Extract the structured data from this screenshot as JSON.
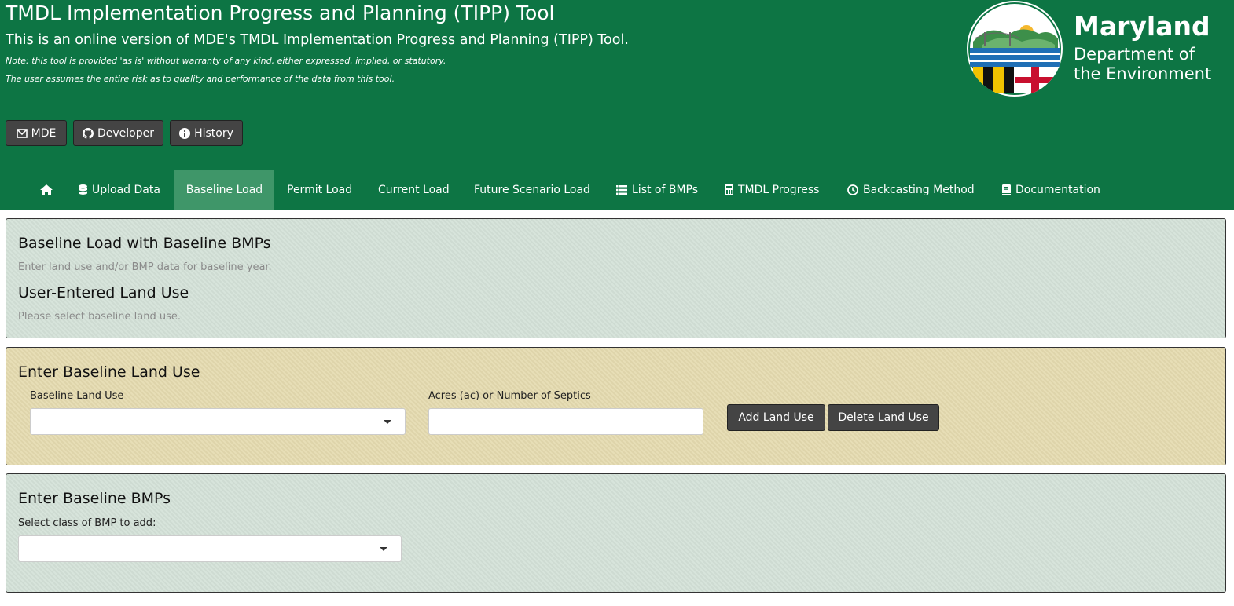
{
  "header": {
    "title": "TMDL Implementation Progress and Planning (TIPP) Tool",
    "subtitle": "This is an online version of MDE's TMDL Implementation Progress and Planning (TIPP) Tool.",
    "note1": "Note: this tool is provided 'as is' without warranty of any kind, either expressed, implied, or statutory.",
    "note2": "The user assumes the entire risk as to quality and performance of the data from this tool.",
    "buttons": [
      {
        "label": "MDE",
        "icon": "envelope-icon"
      },
      {
        "label": "Developer",
        "icon": "github-icon"
      },
      {
        "label": "History",
        "icon": "info-circle-icon"
      }
    ],
    "logo": {
      "line1": "Maryland",
      "line2": "Department of",
      "line3": "the Environment"
    },
    "bg_color": "#0d7544"
  },
  "nav": {
    "active": "Baseline Load",
    "items": [
      {
        "label": "",
        "icon": "home-icon"
      },
      {
        "label": "Upload Data",
        "icon": "database-icon"
      },
      {
        "label": "Baseline Load",
        "icon": ""
      },
      {
        "label": "Permit Load",
        "icon": ""
      },
      {
        "label": "Current Load",
        "icon": ""
      },
      {
        "label": "Future Scenario Load",
        "icon": ""
      },
      {
        "label": "List of BMPs",
        "icon": "list-icon"
      },
      {
        "label": "TMDL Progress",
        "icon": "calculator-icon"
      },
      {
        "label": "Backcasting Method",
        "icon": "clock-icon"
      },
      {
        "label": "Documentation",
        "icon": "book-icon"
      }
    ]
  },
  "panel1": {
    "title": "Baseline Load with Baseline BMPs",
    "help": "Enter land use and/or BMP data for baseline year.",
    "subtitle": "User-Entered Land Use",
    "subhelp": "Please select baseline land use."
  },
  "panel2": {
    "title": "Enter Baseline Land Use",
    "land_use_label": "Baseline Land Use",
    "land_use_value": "",
    "acres_label": "Acres (ac) or Number of Septics",
    "acres_value": "",
    "add_button": "Add Land Use",
    "delete_button": "Delete Land Use"
  },
  "panel3": {
    "title": "Enter Baseline BMPs",
    "class_label": "Select class of BMP to add:",
    "class_value": ""
  },
  "colors": {
    "header_green": "#0d7544",
    "active_tab": "#3f9669",
    "panel_green": "#d5e2d9",
    "panel_tan": "#e5dbb0",
    "button_dark": "#444444"
  }
}
